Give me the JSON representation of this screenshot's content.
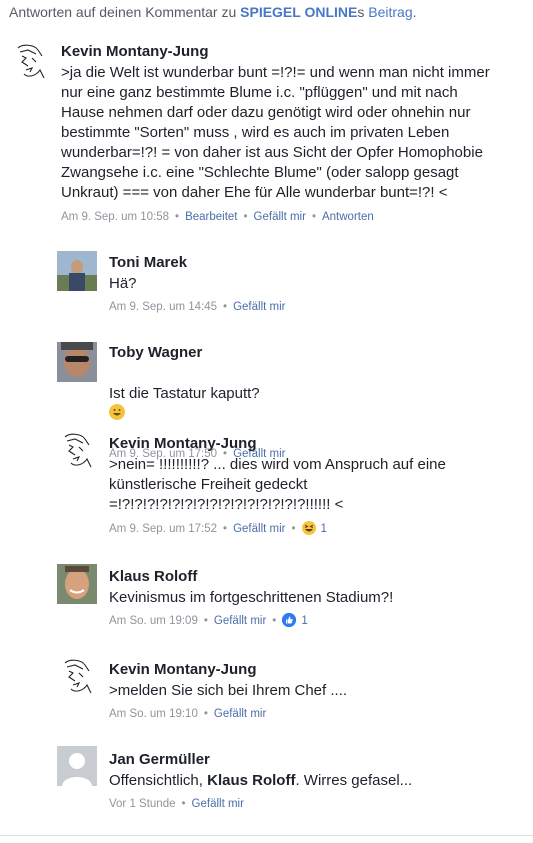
{
  "header": {
    "prefix": "Antworten auf deinen Kommentar zu ",
    "site": "SPIEGEL ONLINE",
    "possessive": "s ",
    "article_link": "Beitrag",
    "suffix": "."
  },
  "comments": [
    {
      "author": "Kevin Montany-Jung",
      "text": ">ja die Welt ist wunderbar bunt =!?!= und wenn man nicht immer\nnur eine ganz bestimmte Blume  i.c.  \"pflüggen\" und mit nach\nHause nehmen darf oder dazu genötigt wird oder ohnehin nur\nbestimmte \"Sorten\"  muss ,   wird es auch im privaten Leben\nwunderbar=!?! = von daher ist aus Sicht der Opfer Homophobie\nZwangsehe i.c. eine \"Schlechte Blume\" (oder salopp gesagt\nUnkraut) === von daher Ehe für Alle wunderbar bunt=!?! <",
      "time": "Am 9. Sep. um 10:58",
      "edited": "Bearbeitet",
      "like": "Gefällt mir",
      "reply": "Antworten"
    }
  ],
  "replies": [
    {
      "author": "Toni Marek",
      "text": "Hä?",
      "time": "Am 9. Sep. um 14:45",
      "like": "Gefällt mir"
    },
    {
      "author": "Toby Wagner",
      "text": "Ist die Tastatur kaputt?",
      "time": "Am 9. Sep. um 17:50",
      "like": "Gefällt mir"
    },
    {
      "author": "Kevin Montany-Jung",
      "text": ">nein= !!!!!!!!!!? ... dies wird vom Anspruch auf eine\nkünstlerische Freiheit gedeckt\n=!?!?!?!?!?!?!?!?!?!?!?!?!?!?!?!!!!!! <",
      "time": "Am 9. Sep. um 17:52",
      "like": "Gefällt mir",
      "reaction_count": "1"
    },
    {
      "author": "Klaus Roloff",
      "text": "Kevinismus im fortgeschrittenen Stadium?!",
      "time": "Am So. um 19:09",
      "like": "Gefällt mir",
      "reaction_count": "1"
    },
    {
      "author": "Kevin Montany-Jung",
      "text": ">melden Sie sich bei Ihrem Chef ....",
      "time": "Am So. um 19:10",
      "like": "Gefällt mir"
    },
    {
      "author": "Jan Germüller",
      "text_prefix": "Offensichtlich, ",
      "mention": "Klaus Roloff",
      "text_suffix": ". Wirres gefasel...",
      "time": "Vor 1 Stunde",
      "like": "Gefällt mir"
    }
  ],
  "icons": {
    "sketch_avatar": "line-drawing-face-icon",
    "default_avatar": "default-profile-silhouette-icon",
    "emoji": "grinning-emoji-icon",
    "laugh_reaction": "laugh-reaction-icon",
    "like_reaction": "like-reaction-icon"
  },
  "colors": {
    "link": "#4b6ea9",
    "header_link": "#4a76c8",
    "meta": "#90949c",
    "like_blue": "#2e7bf3"
  }
}
